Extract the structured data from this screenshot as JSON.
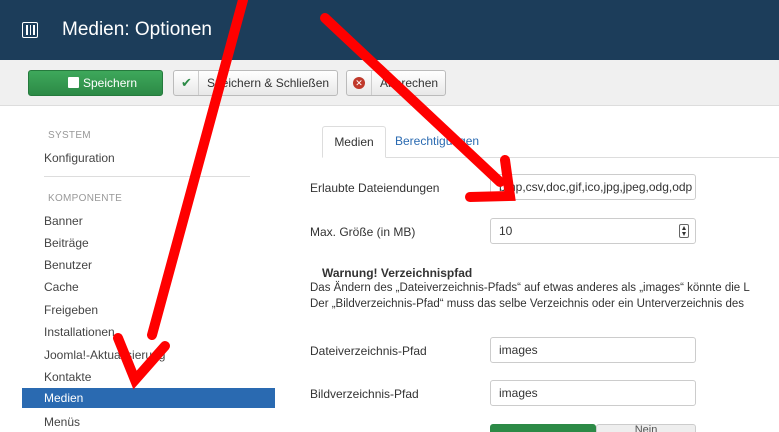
{
  "header": {
    "title": "Medien: Optionen",
    "icon": "joomla-settings-icon"
  },
  "toolbar": {
    "save_label": "Speichern",
    "save_close_label": "Speichern & Schließen",
    "cancel_label": "Abbrechen"
  },
  "sidebar": {
    "system_heading": "SYSTEM",
    "system_items": [
      "Konfiguration"
    ],
    "component_heading": "KOMPONENTE",
    "items": [
      "Banner",
      "Beiträge",
      "Benutzer",
      "Cache",
      "Freigeben",
      "Installationen",
      "Joomla!-Aktualisierung",
      "Kontakte",
      "Medien",
      "Menüs"
    ],
    "active_item": "Medien"
  },
  "tabs": {
    "media": "Medien",
    "permissions": "Berechtigungen"
  },
  "form": {
    "allowed_ext_label": "Erlaubte Dateiendungen",
    "allowed_ext_value": "bmp,csv,doc,gif,ico,jpg,jpeg,odg,odp",
    "max_size_label": "Max. Größe (in MB)",
    "max_size_value": "10",
    "warning_title": "Warnung! Verzeichnispfad",
    "warning_line1": "Das Ändern des „Dateiverzeichnis-Pfads“ auf etwas anderes als „images“ könnte die L",
    "warning_line2": "Der „Bildverzeichnis-Pfad“ muss das selbe Verzeichnis oder ein Unterverzeichnis des",
    "file_path_label": "Dateiverzeichnis-Pfad",
    "file_path_value": "images",
    "image_path_label": "Bildverzeichnis-Pfad",
    "image_path_value": "images",
    "toggle_no_label": "Nein"
  },
  "colors": {
    "header_bg": "#1c3d5a",
    "save_green": "#2c8a46",
    "active_blue": "#2a6ab1",
    "annotation_red": "#ff0000"
  }
}
